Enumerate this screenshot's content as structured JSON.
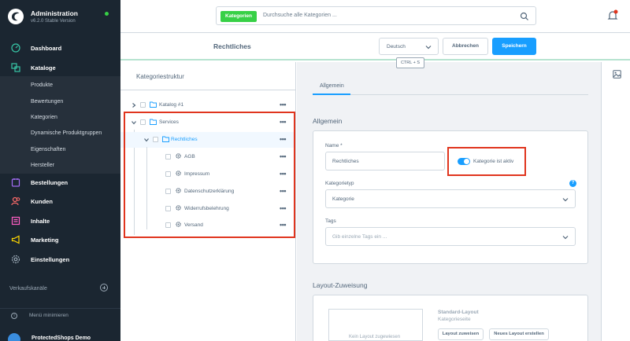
{
  "brand": {
    "title": "Administration",
    "version": "v6.2.0 Stable Version"
  },
  "nav": {
    "dashboard": "Dashboard",
    "kataloge": "Kataloge",
    "bestellungen": "Bestellungen",
    "kunden": "Kunden",
    "inhalte": "Inhalte",
    "marketing": "Marketing",
    "einstellungen": "Einstellungen",
    "sub": [
      "Produkte",
      "Bewertungen",
      "Kategorien",
      "Dynamische Produktgruppen",
      "Eigenschaften",
      "Hersteller"
    ]
  },
  "sidebar_footer": {
    "channels": "Verkaufskanäle",
    "minimize": "Menü minimieren",
    "user": "ProtectedShops Demo"
  },
  "search": {
    "tag": "Kategorien",
    "placeholder": "Durchsuche alle Kategorien ..."
  },
  "header": {
    "page_title": "Rechtliches",
    "language": "Deutsch",
    "cancel": "Abbrechen",
    "save": "Speichern",
    "shortcut": "CTRL + S"
  },
  "tree": {
    "title": "Kategoriestruktur",
    "items": [
      {
        "name": "Katalog #1"
      },
      {
        "name": "Services"
      },
      {
        "name": "Rechtliches"
      },
      {
        "name": "AGB"
      },
      {
        "name": "Impressum"
      },
      {
        "name": "Datenschutzerklärung"
      },
      {
        "name": "Widerrufsbelehrung"
      },
      {
        "name": "Versand"
      }
    ],
    "dots": "•••"
  },
  "tabs": {
    "general": "Allgemein"
  },
  "general": {
    "title": "Allgemein",
    "name_label": "Name *",
    "name_value": "Rechtliches",
    "active_label": "Kategorie ist aktiv",
    "type_label": "Kategorietyp",
    "type_value": "Kategorie",
    "tags_label": "Tags",
    "tags_placeholder": "Gib einzelne Tags ein ...",
    "help": "?"
  },
  "layout": {
    "title": "Layout-Zuweisung",
    "empty": "Kein Layout zugewiesen",
    "std_label": "Standard-Layout",
    "std_sub": "Kategorieseite",
    "assign": "Layout zuweisen",
    "create": "Neues Layout erstellen"
  },
  "colors": {
    "accent": "#189eff",
    "sidebar": "#1b2631",
    "highlight": "#e0351e",
    "success": "#37d046"
  }
}
